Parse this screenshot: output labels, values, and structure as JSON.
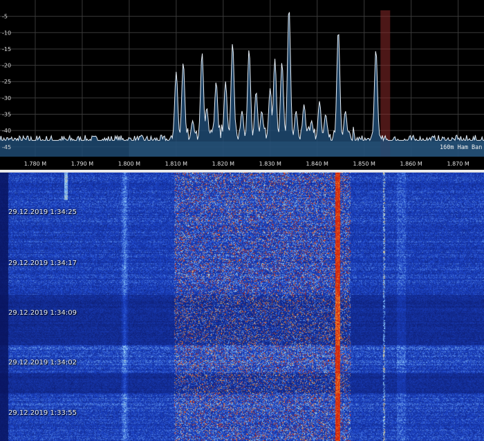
{
  "colors": {
    "background": "#000000",
    "grid": "#3a3a3a",
    "trace": "#e6eef6",
    "fill": "#1f4a72",
    "band_highlight": "#6a8fb0",
    "marker": "#8a2a2a",
    "waterfall_base": "#1a2e8c"
  },
  "spectrum": {
    "y_ticks": [
      "-5",
      "-10",
      "-15",
      "-20",
      "-25",
      "-30",
      "-35",
      "-40",
      "-45"
    ],
    "x_ticks": [
      "1.780 M",
      "1.790 M",
      "1.800 M",
      "1.810 M",
      "1.820 M",
      "1.830 M",
      "1.840 M",
      "1.850 M",
      "1.860 M",
      "1.870 M"
    ],
    "band_label": "160m Ham Ban",
    "band_range_mhz": [
      1.8,
      1.875
    ],
    "marker_mhz": 1.8545
  },
  "chart_data": {
    "type": "line",
    "xlabel": "",
    "ylabel": "",
    "x_unit": "MHz",
    "xlim": [
      1.7725,
      1.8755
    ],
    "ylim": [
      -48,
      0
    ],
    "grid": true,
    "baseline_db": -43,
    "peaks": [
      {
        "x": 1.81,
        "y": -22
      },
      {
        "x": 1.8115,
        "y": -19
      },
      {
        "x": 1.8135,
        "y": -37
      },
      {
        "x": 1.8155,
        "y": -16
      },
      {
        "x": 1.8165,
        "y": -33
      },
      {
        "x": 1.8185,
        "y": -25
      },
      {
        "x": 1.8205,
        "y": -25
      },
      {
        "x": 1.822,
        "y": -13
      },
      {
        "x": 1.824,
        "y": -34
      },
      {
        "x": 1.8255,
        "y": -15
      },
      {
        "x": 1.827,
        "y": -28
      },
      {
        "x": 1.8282,
        "y": -34
      },
      {
        "x": 1.83,
        "y": -27
      },
      {
        "x": 1.831,
        "y": -18
      },
      {
        "x": 1.8325,
        "y": -19
      },
      {
        "x": 1.834,
        "y": -2
      },
      {
        "x": 1.8355,
        "y": -34
      },
      {
        "x": 1.8372,
        "y": -32
      },
      {
        "x": 1.8388,
        "y": -37
      },
      {
        "x": 1.8405,
        "y": -31
      },
      {
        "x": 1.8418,
        "y": -35
      },
      {
        "x": 1.8445,
        "y": -9
      },
      {
        "x": 1.846,
        "y": -34
      },
      {
        "x": 1.8525,
        "y": -15
      }
    ]
  },
  "waterfall": {
    "timestamps": [
      "29.12.2019 1:34:25",
      "29.12.2019 1:34:17",
      "29.12.2019 1:34:09",
      "29.12.2019 1:34:02",
      "29.12.2019 1:33:55"
    ]
  }
}
